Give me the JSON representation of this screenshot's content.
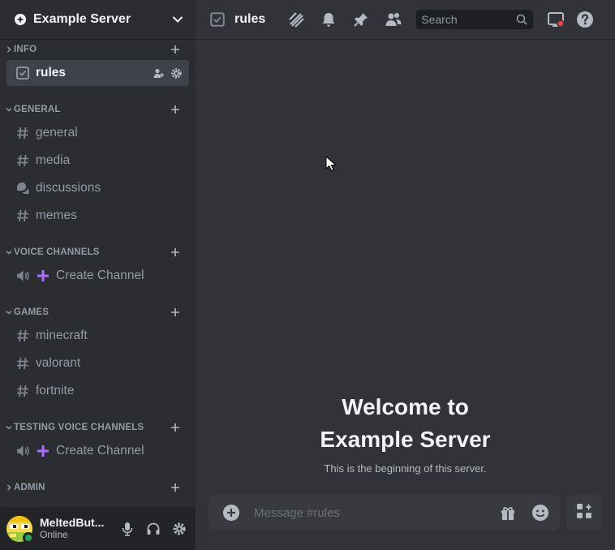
{
  "server": {
    "name": "Example Server"
  },
  "categories": {
    "info": "INFO",
    "general": "GENERAL",
    "voice": "VOICE CHANNELS",
    "games": "GAMES",
    "testing_voice": "TESTING VOICE CHANNELS",
    "admin": "ADMIN"
  },
  "channels": {
    "rules": "rules",
    "general": "general",
    "media": "media",
    "discussions": "discussions",
    "memes": "memes",
    "voice_create": "Create Channel",
    "minecraft": "minecraft",
    "valorant": "valorant",
    "fortnite": "fortnite",
    "testing_create": "Create Channel"
  },
  "user": {
    "name": "MeltedBut...",
    "status": "Online"
  },
  "topbar": {
    "title": "rules",
    "search_placeholder": "Search"
  },
  "welcome": {
    "line1": "Welcome to",
    "line2": "Example Server",
    "subtitle": "This is the beginning of this server."
  },
  "composer": {
    "placeholder": "Message #rules"
  },
  "colors": {
    "accent": "#5865f2",
    "online": "#23a55a",
    "create_plus": "#a970ff",
    "notify": "#f23f42"
  }
}
